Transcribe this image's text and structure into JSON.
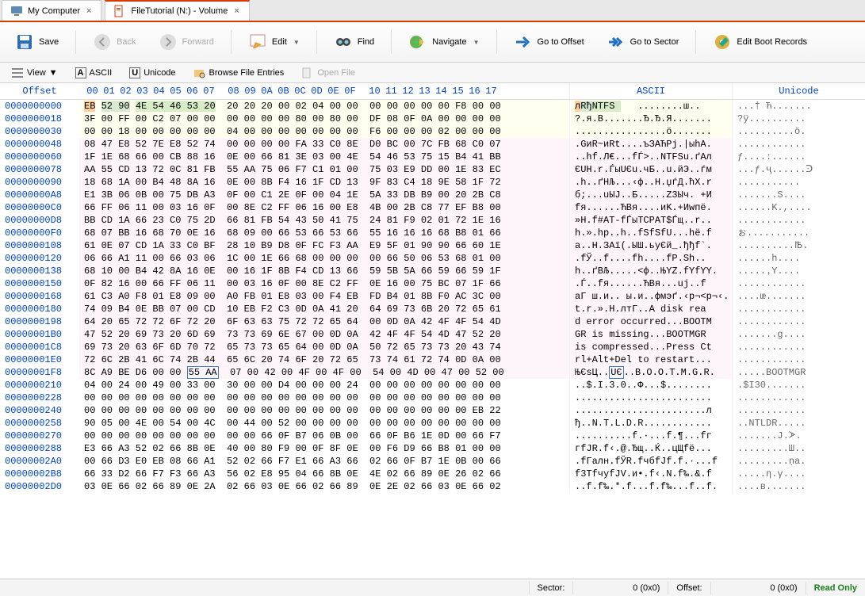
{
  "tabs": [
    {
      "label": "My Computer",
      "icon": "computer-icon"
    },
    {
      "label": "FileTutorial (N:) - Volume",
      "icon": "file-icon"
    }
  ],
  "toolbar": {
    "save": "Save",
    "back": "Back",
    "forward": "Forward",
    "edit": "Edit",
    "find": "Find",
    "navigate": "Navigate",
    "goto_offset": "Go to Offset",
    "goto_sector": "Go to Sector",
    "boot": "Edit Boot Records"
  },
  "subtoolbar": {
    "view": "View",
    "ascii": "ASCII",
    "unicode": "Unicode",
    "browse": "Browse File Entries",
    "open_file": "Open File"
  },
  "headers": {
    "offset": "Offset",
    "hexcols": [
      "00",
      "01",
      "02",
      "03",
      "04",
      "05",
      "06",
      "07",
      "08",
      "09",
      "0A",
      "0B",
      "0C",
      "0D",
      "0E",
      "0F",
      "10",
      "11",
      "12",
      "13",
      "14",
      "15",
      "16",
      "17"
    ],
    "ascii": "ASCII",
    "unicode": "Unicode"
  },
  "rows": [
    {
      "offset": "0000000000",
      "hex": "EB 52 90 4E 54 46 53 20  20 20 20 00 02 04 00 00  00 00 00 00 00 F8 00 00",
      "ascii": "лRђNTFS    ........ш..",
      "uni": "...† Ћ.......",
      "region": "r0"
    },
    {
      "offset": "0000000018",
      "hex": "3F 00 FF 00 C2 07 00 00  00 00 00 00 80 00 80 00  DF 08 0F 0A 00 00 00 00",
      "ascii": "?.я.В.......Ђ.Ђ.Я.......",
      "uni": "?ÿ..........",
      "region": "r0"
    },
    {
      "offset": "0000000030",
      "hex": "00 00 18 00 00 00 00 00  04 00 00 00 00 00 00 00  F6 00 00 00 02 00 00 00",
      "ascii": "................ö.......",
      "uni": "..........ö.",
      "region": "r0"
    },
    {
      "offset": "0000000048",
      "hex": "08 47 E8 52 7E E8 52 74  00 00 00 00 FA 33 C0 8E  D0 BC 00 7C FB 68 C0 07",
      "ascii": ".GиR~иRt....ъЗАЋРј.|ыhА.",
      "uni": "............",
      "region": "r3"
    },
    {
      "offset": "0000000060",
      "hex": "1F 1E 68 66 00 CB 88 16  0E 00 66 81 3E 03 00 4E  54 46 53 75 15 B4 41 BB",
      "ascii": "..hf.Л€...fЃ>..NTFSu.ґAл",
      "uni": "ƒ....:......",
      "region": "r3"
    },
    {
      "offset": "0000000078",
      "hex": "AA 55 CD 13 72 0C 81 FB  55 AA 75 06 F7 C1 01 00  75 03 E9 DD 00 1E 83 EC",
      "ascii": "ЄUН.r.ЃыUЄu.чБ..u.йЭ..ѓм",
      "uni": "...ƒ.ҷ......ᑔ",
      "region": "r3"
    },
    {
      "offset": "0000000090",
      "hex": "18 68 1A 00 B4 48 8A 16  0E 00 8B F4 16 1F CD 13  9F 83 C4 18 9E 58 1F 72",
      "ascii": ".h..ґHЉ...‹ф..Н.џѓД.ћX.r",
      "uni": "᩟...........",
      "region": "r3"
    },
    {
      "offset": "00000000A8",
      "hex": "E1 3B 06 0B 00 75 DB A3  0F 00 C1 2E 0F 00 04 1E  5A 33 DB B9 00 20 2B C8",
      "ascii": "б;...uЫЈ..Б.....Z3Ыч. +И",
      "uni": ".......Ѕ....",
      "region": "r3"
    },
    {
      "offset": "00000000C0",
      "hex": "66 FF 06 11 00 03 16 0F  00 8E C2 FF 06 16 00 E8  4B 00 2B C8 77 EF B8 00",
      "ascii": "fя......ЋВя....иK.+Иwпё.",
      "uni": "......K.,....",
      "region": "r3"
    },
    {
      "offset": "00000000D8",
      "hex": "BB CD 1A 66 23 C0 75 2D  66 81 FB 54 43 50 41 75  24 81 F9 02 01 72 1E 16",
      "ascii": "»Н.f#АТ-fЃыTCPAТ$Ѓщ..r..",
      "uni": "............",
      "region": "r3"
    },
    {
      "offset": "00000000F0",
      "hex": "68 07 BB 16 68 70 0E 16  68 09 00 66 53 66 53 66  55 16 16 16 68 B8 01 66",
      "ascii": "h.».hp..h..fSfSfU...hё.f",
      "uni": "ぉ...........",
      "region": "r3"
    },
    {
      "offset": "0000000108",
      "hex": "61 0E 07 CD 1A 33 C0 BF  28 10 B9 D8 0F FC F3 AA  E9 5F 01 90 90 66 60 1E",
      "ascii": "a..Н.ЗАї(.ЫШ.ьуЄй_.ђђf`.",
      "uni": "..........Ꙓ.",
      "region": "r3"
    },
    {
      "offset": "0000000120",
      "hex": "06 66 A1 11 00 66 03 06  1C 00 1E 66 68 00 00 00  00 66 50 06 53 68 01 00",
      "ascii": ".fЎ..f....fh....fP.Sh..",
      "uni": ".....᛾.h....",
      "region": "r3"
    },
    {
      "offset": "0000000138",
      "hex": "68 10 00 B4 42 8A 16 0E  00 16 1F 8B F4 CD 13 66  59 5B 5A 66 59 66 59 1F",
      "ascii": "h..ґBЉ.....<ф..ЊYZ.fYfYY.",
      "uni": "......ָY....",
      "region": "r3"
    },
    {
      "offset": "0000000150",
      "hex": "0F 82 16 00 66 FF 06 11  00 03 16 0F 00 8E C2 FF  0E 16 00 75 BC 07 1F 66",
      "ascii": ".Ѓ..fя......ЋВя...uј..f",
      "uni": "............",
      "region": "r3"
    },
    {
      "offset": "0000000168",
      "hex": "61 C3 A0 F8 01 E8 09 00  A0 FB 01 E8 03 00 F4 EB  FD B4 01 8B F0 AC 3C 00",
      "ascii": "aГ ш.и.. ы.и..фмэґ.‹р¬<p¬‹.",
      "uni": "....ᵫ.......",
      "region": "r3"
    },
    {
      "offset": "0000000180",
      "hex": "74 09 B4 0E BB 07 00 CD  10 EB F2 C3 0D 0A 41 20  64 69 73 6B 20 72 65 61",
      "ascii": "t.r.».Н.лтГ..A disk rea",
      "uni": "............",
      "region": "r3"
    },
    {
      "offset": "0000000198",
      "hex": "64 20 65 72 72 6F 72 20  6F 63 63 75 72 72 65 64  00 0D 0A 42 4F 4F 54 4D",
      "ascii": "d error occurred...BOOTM",
      "uni": "............",
      "region": "r3"
    },
    {
      "offset": "00000001B0",
      "hex": "47 52 20 69 73 20 6D 69  73 73 69 6E 67 00 0D 0A  42 4F 4F 54 4D 47 52 20",
      "ascii": "GR is missing...BOOTMGR ",
      "uni": ".......g....",
      "region": "r3"
    },
    {
      "offset": "00000001C8",
      "hex": "69 73 20 63 6F 6D 70 72  65 73 73 65 64 00 0D 0A  50 72 65 73 73 20 43 74",
      "ascii": "is compressed...Press Ct",
      "uni": "............",
      "region": "r3"
    },
    {
      "offset": "00000001E0",
      "hex": "72 6C 2B 41 6C 74 2B 44  65 6C 20 74 6F 20 72 65  73 74 61 72 74 0D 0A 00",
      "ascii": "rl+Alt+Del to restart...",
      "uni": "............",
      "region": "r3"
    },
    {
      "offset": "00000001F8",
      "hex": "8C A9 BE D6 00 00 55 AA  07 00 42 00 4F 00 4F 00  54 00 4D 00 47 00 52 00",
      "ascii": "ЊЄѕЦ..UЄ..B.O.O.T.M.G.R.",
      "uni": ".....BOOTMGR",
      "region": "r4"
    },
    {
      "offset": "0000000210",
      "hex": "04 00 24 00 49 00 33 00  30 00 00 D4 00 00 00 24  00 00 00 00 00 00 00 00",
      "ascii": "..$.I.3.0..Ф...$........",
      "uni": ".$I30.......",
      "region": ""
    },
    {
      "offset": "0000000228",
      "hex": "00 00 00 00 00 00 00 00  00 00 00 00 00 00 00 00  00 00 00 00 00 00 00 00",
      "ascii": "........................",
      "uni": "............",
      "region": ""
    },
    {
      "offset": "0000000240",
      "hex": "00 00 00 00 00 00 00 00  00 00 00 00 00 00 00 00  00 00 00 00 00 00 EB 22",
      "ascii": ".......................л",
      "uni": "............",
      "region": ""
    },
    {
      "offset": "0000000258",
      "hex": "90 05 00 4E 00 54 00 4C  00 44 00 52 00 00 00 00  00 00 00 00 00 00 00 00",
      "ascii": "ђ..N.T.L.D.R............",
      "uni": "..NTLDR.....",
      "region": ""
    },
    {
      "offset": "0000000270",
      "hex": "00 00 00 00 00 00 00 00  00 00 66 0F B7 06 0B 00  66 0F B6 1E 0D 00 66 F7",
      "ascii": "..........f.·...f.¶...fг",
      "uni": ".......Ј.ᗆ.",
      "region": ""
    },
    {
      "offset": "0000000288",
      "hex": "E3 66 A3 52 02 66 8B 0E  40 00 80 F9 00 0F 8F 0E  00 F6 D9 66 B8 01 00 00",
      "ascii": "гfЈR.f‹.@.Ђщ..Ќ..цЩfё...",
      "uni": ".........Ш..",
      "region": ""
    },
    {
      "offset": "00000002A0",
      "hex": "00 66 D3 E0 EB 08 66 A1  52 02 66 F7 E1 66 A3 66  02 66 0F B7 1E 0B 00 66",
      "ascii": ".fГалн.fЎR.fчбfЈf.f.·...f",
      "uni": ".........ṇa.",
      "region": ""
    },
    {
      "offset": "00000002B8",
      "hex": "66 33 D2 66 F7 F3 66 A3  56 02 E8 95 04 66 8B 0E  4E 02 66 89 0E 26 02 66",
      "ascii": "f3ТfчуfЈV.и•.f‹.N.f‰.&.f",
      "uni": ".....η.γ....",
      "region": ""
    },
    {
      "offset": "00000002D0",
      "hex": "03 0E 66 02 66 89 0E 2A  02 66 03 0E 66 02 66 89  0E 2E 02 66 03 0E 66 02",
      "ascii": "..f.f‰.*.f...f.f‰...f..f.",
      "uni": "....в.......",
      "region": ""
    }
  ],
  "status": {
    "sector_label": "Sector:",
    "sector_value": "0 (0x0)",
    "offset_label": "Offset:",
    "offset_value": "0 (0x0)",
    "mode": "Read Only"
  }
}
